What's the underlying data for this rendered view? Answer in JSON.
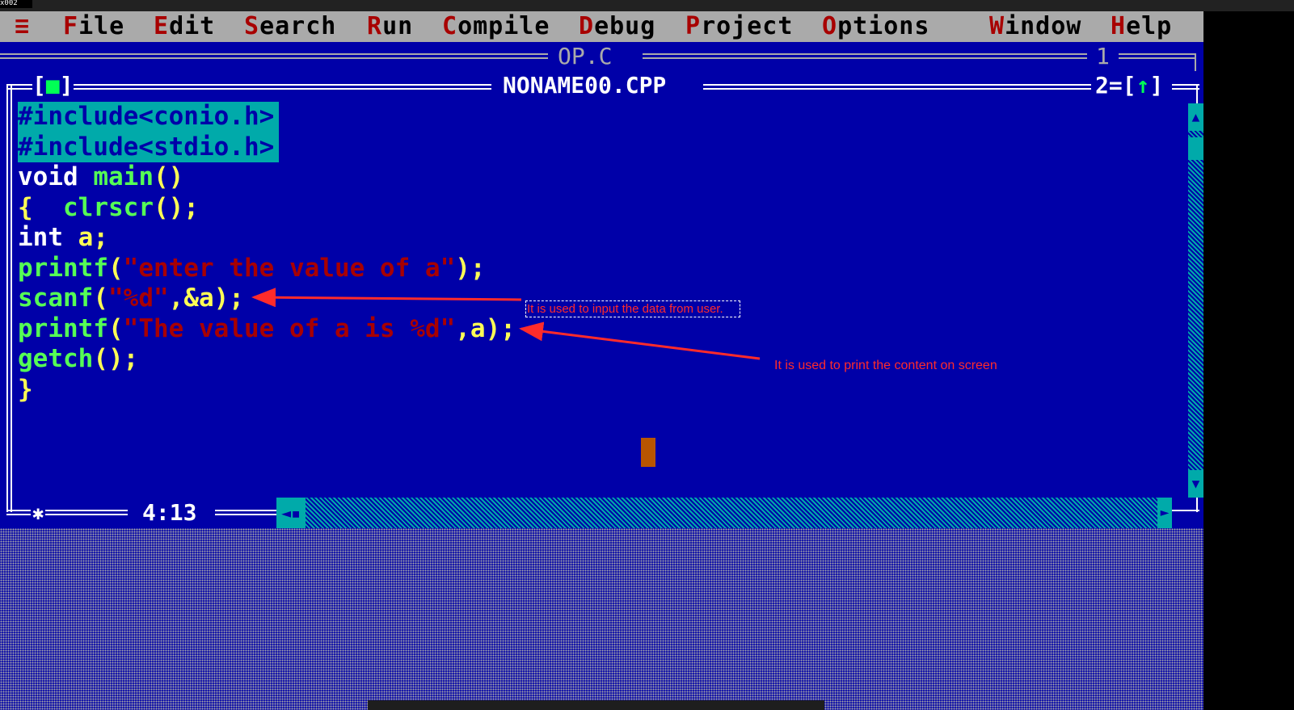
{
  "corner": {
    "label": "x002"
  },
  "menu": {
    "system_glyph": "≡",
    "items": [
      {
        "hotkey": "F",
        "rest": "ile"
      },
      {
        "hotkey": "E",
        "rest": "dit"
      },
      {
        "hotkey": "S",
        "rest": "earch"
      },
      {
        "hotkey": "R",
        "rest": "un"
      },
      {
        "hotkey": "C",
        "rest": "ompile"
      },
      {
        "hotkey": "D",
        "rest": "ebug"
      },
      {
        "hotkey": "P",
        "rest": "roject"
      },
      {
        "hotkey": "O",
        "rest": "ptions"
      },
      {
        "hotkey": "W",
        "rest": "indow"
      },
      {
        "hotkey": "H",
        "rest": "elp"
      }
    ]
  },
  "background_window": {
    "title": "OP.C",
    "number": "1"
  },
  "editor_window": {
    "title": "NONAME00.CPP",
    "close_left": "[",
    "close_glyph": "■",
    "close_right": "]",
    "number": "2",
    "zoom_left": "=[",
    "zoom_glyph": "↑",
    "zoom_right": "]"
  },
  "code": {
    "line1": "#include<conio.h>",
    "line2": "#include<stdio.h>",
    "line3_kw": "void ",
    "line3_fn": "main",
    "line3_pu": "()",
    "line4_pu": "{  ",
    "line4_fn": "clrscr",
    "line4_pu2": "();",
    "line5_kw": "int ",
    "line5_id": "a",
    "line5_pu": ";",
    "line6_fn": "printf",
    "line6_pu": "(",
    "line6_st": "\"enter the value of a\"",
    "line6_pu2": ");",
    "line7_fn": "scanf",
    "line7_pu": "(",
    "line7_st": "\"%d\"",
    "line7_pu2": ",&a);",
    "line8_fn": "printf",
    "line8_pu": "(",
    "line8_st": "\"The value of a is %d\"",
    "line8_pu2": ",a);",
    "line9_fn": "getch",
    "line9_pu": "();",
    "line10_pu": "}"
  },
  "status": {
    "cursor_position": "4:13",
    "modified_marker": "✱"
  },
  "annotations": {
    "scanf_note": "It is used to input the data from user.",
    "printf_note": "It is used to print the content on screen"
  },
  "colors": {
    "screen": "#0000a8",
    "menu_bar": "#aaaaaa",
    "hotkey": "#a80000",
    "selection": "#00aaaa",
    "annotation": "#ff2b2b"
  }
}
